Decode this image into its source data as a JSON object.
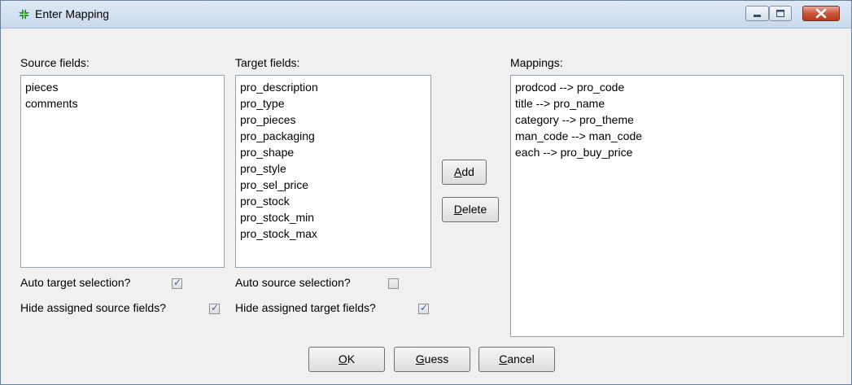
{
  "window": {
    "title": "Enter Mapping"
  },
  "source": {
    "label": "Source fields:",
    "items": [
      "pieces",
      "comments"
    ],
    "auto_label": "Auto target selection?",
    "auto_checked": true,
    "hide_label": "Hide assigned source fields?",
    "hide_checked": true
  },
  "target": {
    "label": "Target fields:",
    "items": [
      "pro_description",
      "pro_type",
      "pro_pieces",
      "pro_packaging",
      "pro_shape",
      "pro_style",
      "pro_sel_price",
      "pro_stock",
      "pro_stock_min",
      "pro_stock_max"
    ],
    "auto_label": "Auto source selection?",
    "auto_checked": false,
    "hide_label": "Hide assigned target fields?",
    "hide_checked": true
  },
  "mappings": {
    "label": "Mappings:",
    "items": [
      "prodcod --> pro_code",
      "title --> pro_name",
      "category --> pro_theme",
      "man_code --> man_code",
      "each --> pro_buy_price"
    ]
  },
  "buttons": {
    "add": {
      "mnemonic": "A",
      "rest": "dd"
    },
    "delete": {
      "mnemonic": "D",
      "rest": "elete"
    },
    "ok": {
      "mnemonic": "O",
      "rest": "K"
    },
    "guess": {
      "mnemonic": "G",
      "rest": "uess"
    },
    "cancel": {
      "mnemonic": "C",
      "rest": "ancel"
    }
  },
  "icons": {
    "app": "arrows-in-icon",
    "minimize": "minimize-icon",
    "maximize": "maximize-icon",
    "close": "close-icon"
  },
  "colors": {
    "app_icon": "#2e9a2e",
    "close_button": "#c8553a",
    "check": "#3c5aa8"
  }
}
